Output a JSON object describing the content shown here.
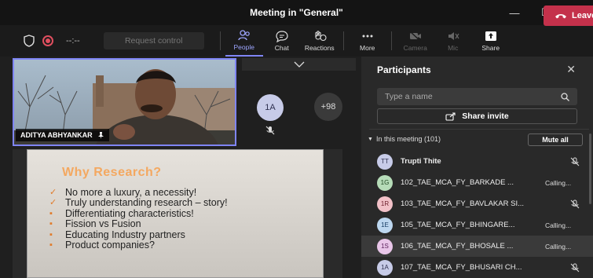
{
  "window": {
    "title": "Meeting in \"General\""
  },
  "toolbar": {
    "timer": "--:--",
    "request_control": "Request control",
    "people": "People",
    "chat": "Chat",
    "reactions": "Reactions",
    "more": "More",
    "camera": "Camera",
    "mic": "Mic",
    "share": "Share",
    "leave": "Leave"
  },
  "stage": {
    "speaker_name": "ADITYA ABHYANKAR",
    "tile_1a": "1A",
    "overflow_count": "+98"
  },
  "slide": {
    "title": "Why Research?",
    "bullets": [
      "No more a luxury, a necessity!",
      "Truly understanding research – story!",
      "Differentiating characteristics!",
      "Fission vs Fusion",
      "Educating Industry partners",
      "Product companies?"
    ]
  },
  "participants": {
    "header": "Participants",
    "search_placeholder": "Type a name",
    "share_invite": "Share invite",
    "in_meeting": "In this meeting (101)",
    "mute_all": "Mute all",
    "list": [
      {
        "initials": "TT",
        "name": "Trupti Thite",
        "status": "",
        "color": "#c7cbe8"
      },
      {
        "initials": "1G",
        "name": "102_TAE_MCA_FY_BARKADE ...",
        "status": "Calling...",
        "color": "#b6dcb8"
      },
      {
        "initials": "1R",
        "name": "103_TAE_MCA_FY_BAVLAKAR SI...",
        "status": "",
        "color": "#f2c1c8"
      },
      {
        "initials": "1E",
        "name": "105_TAE_MCA_FY_BHINGARE...",
        "status": "Calling...",
        "color": "#bdd7f0"
      },
      {
        "initials": "1S",
        "name": "106_TAE_MCA_FY_BHOSALE ...",
        "status": "Calling...",
        "color": "#e9c6e9"
      },
      {
        "initials": "1A",
        "name": "107_TAE_MCA_FY_BHUSARI CH...",
        "status": "",
        "color": "#c7cbe8"
      }
    ]
  }
}
